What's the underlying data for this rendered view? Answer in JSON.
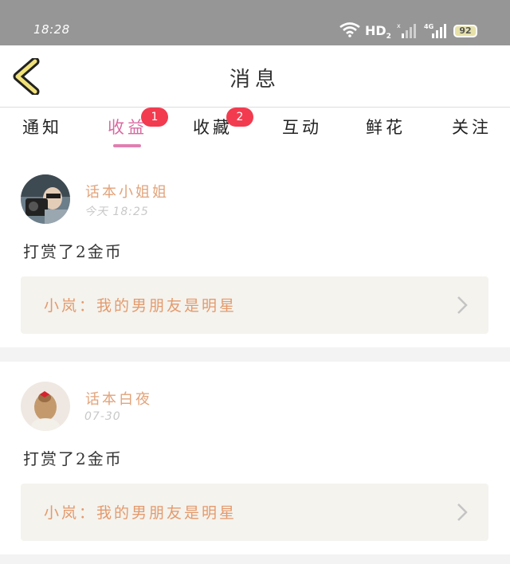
{
  "status_bar": {
    "time": "18:28",
    "network_label": "HD",
    "network_sub": "2",
    "signal_label": "4G",
    "battery": "92"
  },
  "header": {
    "title": "消息"
  },
  "tabs": [
    {
      "label": "通知",
      "badge": ""
    },
    {
      "label": "收益",
      "badge": "1",
      "active": true
    },
    {
      "label": "收藏",
      "badge": "2"
    },
    {
      "label": "互动",
      "badge": ""
    },
    {
      "label": "鲜花",
      "badge": ""
    },
    {
      "label": "关注",
      "badge": ""
    }
  ],
  "feed": [
    {
      "username": "话本小姐姐",
      "timestamp": "今天 18:25",
      "message": "打赏了2金币",
      "quote": "小岚：我的男朋友是明星"
    },
    {
      "username": "话本白夜",
      "timestamp": "07-30",
      "message": "打赏了2金币",
      "quote": "小岚：我的男朋友是明星"
    }
  ],
  "colors": {
    "accent": "#d86aa0",
    "username": "#e2a37a",
    "quote": "#e49a6c",
    "badge": "#f23b4f"
  }
}
